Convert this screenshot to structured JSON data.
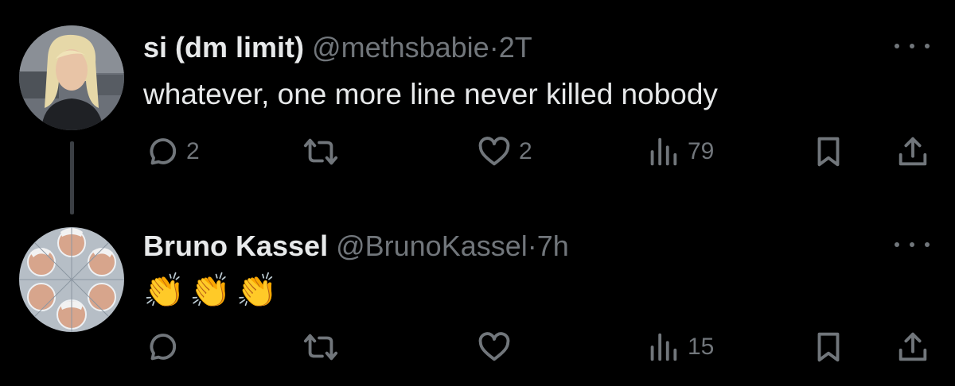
{
  "tweets": [
    {
      "name": "si (dm limit)",
      "handle": "@methsbabie",
      "separator": "·",
      "time": "2T",
      "text": "whatever, one more line never killed nobody",
      "replies": "2",
      "reposts": "",
      "likes": "2",
      "views": "79"
    },
    {
      "name": "Bruno Kassel",
      "handle": "@BrunoKassel",
      "separator": "·",
      "time": "7h",
      "emojis": [
        "👏",
        "👏",
        "👏"
      ],
      "replies": "",
      "reposts": "",
      "likes": "",
      "views": "15"
    }
  ],
  "icons": {
    "reply": "reply-icon",
    "repost": "repost-icon",
    "like": "like-icon",
    "views": "views-icon",
    "bookmark": "bookmark-icon",
    "share": "share-icon",
    "more": "more-icon"
  },
  "colors": {
    "background": "#000000",
    "text": "#e7e9ea",
    "muted": "#71767b",
    "thread_line": "#3b3f44"
  }
}
